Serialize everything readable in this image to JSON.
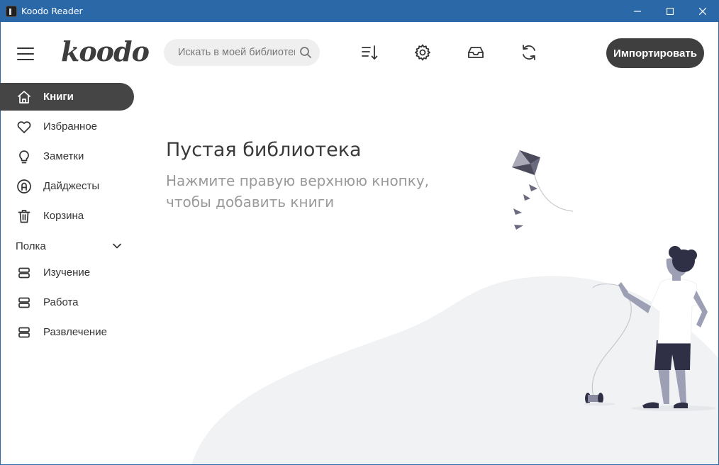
{
  "window": {
    "title": "Koodo Reader"
  },
  "header": {
    "logo": "koodo",
    "search_placeholder": "Искать в моей библиотеке",
    "import_label": "Импортировать"
  },
  "sidebar": {
    "items": [
      {
        "label": "Книги",
        "icon": "home-icon",
        "active": true
      },
      {
        "label": "Избранное",
        "icon": "heart-icon"
      },
      {
        "label": "Заметки",
        "icon": "bulb-icon"
      },
      {
        "label": "Дайджесты",
        "icon": "highlight-icon"
      },
      {
        "label": "Корзина",
        "icon": "trash-icon"
      }
    ],
    "shelf_title": "Полка",
    "shelves": [
      {
        "label": "Изучение",
        "icon": "shelf-icon"
      },
      {
        "label": "Работа",
        "icon": "shelf-icon"
      },
      {
        "label": "Развлечение",
        "icon": "shelf-icon"
      }
    ]
  },
  "empty": {
    "title": "Пустая библиотека",
    "line1": "Нажмите правую верхнюю кнопку,",
    "line2": "чтобы добавить книги"
  },
  "colors": {
    "titlebar": "#2b68a8",
    "active_nav": "#454545",
    "button": "#3f3f3f",
    "search_bg": "#efefef"
  }
}
